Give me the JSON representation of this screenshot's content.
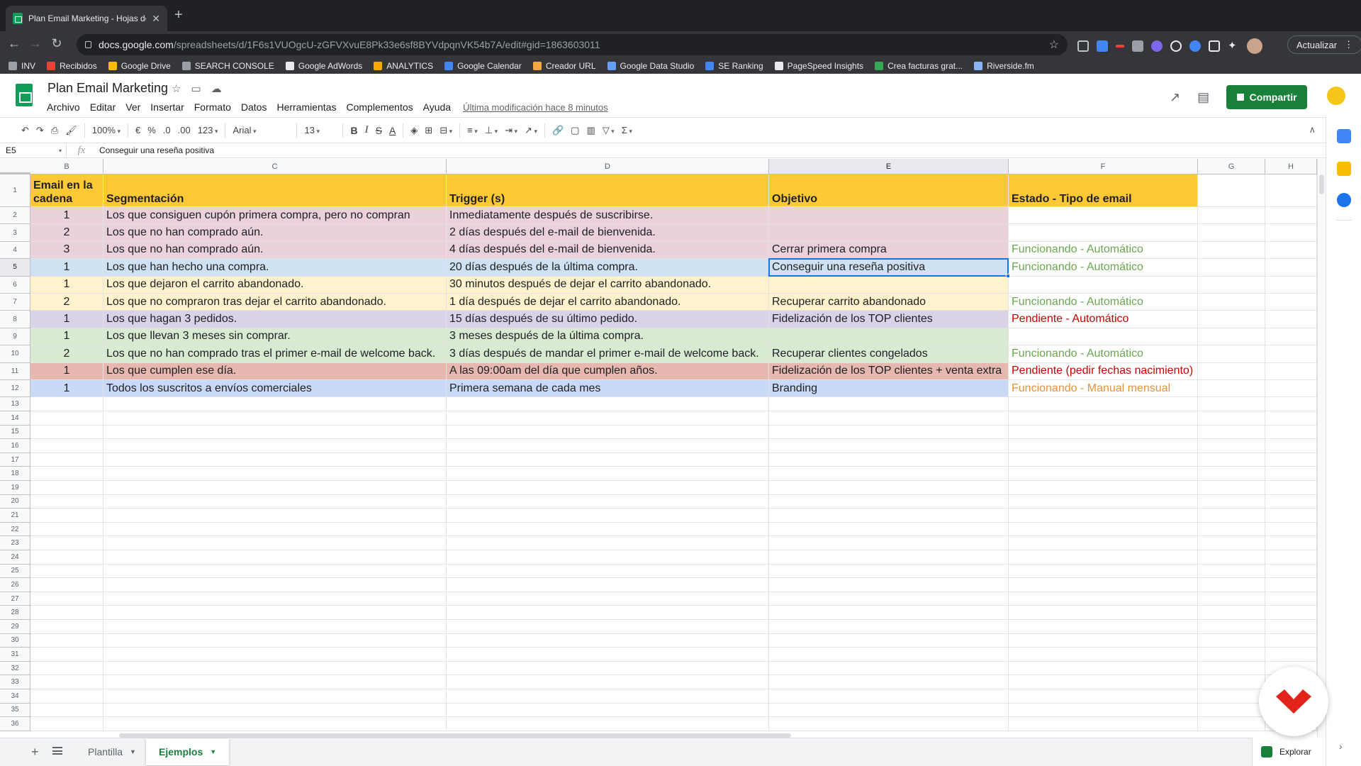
{
  "browser": {
    "tab_title": "Plan Email Marketing - Hojas de cálculo de Google",
    "url_host": "docs.google.com",
    "url_path": "/spreadsheets/d/1F6s1VUOgcU-zGFVXvuE8Pk33e6sf8BYVdpqnVK54b7A/edit#gid=1863603011",
    "update_label": "Actualizar",
    "bookmarks": [
      {
        "label": "INV",
        "color": "#9aa0a6"
      },
      {
        "label": "Recibidos",
        "color": "#ea4335"
      },
      {
        "label": "Google Drive",
        "color": "#fbbc04"
      },
      {
        "label": "SEARCH CONSOLE",
        "color": "#9aa0a6"
      },
      {
        "label": "Google AdWords",
        "color": "#e8eaed"
      },
      {
        "label": "ANALYTICS",
        "color": "#f9ab00"
      },
      {
        "label": "Google Calendar",
        "color": "#4285f4"
      },
      {
        "label": "Creador URL",
        "color": "#f4a742"
      },
      {
        "label": "Google Data Studio",
        "color": "#669df6"
      },
      {
        "label": "SE Ranking",
        "color": "#4285f4"
      },
      {
        "label": "PageSpeed Insights",
        "color": "#e8eaed"
      },
      {
        "label": "Crea facturas grat...",
        "color": "#34a853"
      },
      {
        "label": "Riverside.fm",
        "color": "#8ab4f8"
      }
    ]
  },
  "doc": {
    "title": "Plan Email Marketing",
    "menus": [
      "Archivo",
      "Editar",
      "Ver",
      "Insertar",
      "Formato",
      "Datos",
      "Herramientas",
      "Complementos",
      "Ayuda"
    ],
    "last_edit": "Última modificación hace 8 minutos",
    "share_label": "Compartir"
  },
  "format_toolbar": {
    "zoom": "100%",
    "currency": "€",
    "percent": "%",
    "decimal_less": ".0",
    "decimal_more": ".00",
    "more_formats": "123",
    "font": "Arial",
    "font_size": "13"
  },
  "formula_bar": {
    "cell_ref": "E5",
    "fx": "fx",
    "content": "Conseguir una reseña positiva"
  },
  "columns": [
    "B",
    "C",
    "D",
    "E",
    "F",
    "G",
    "H"
  ],
  "selected_column": "E",
  "selected_row": 5,
  "row_numbers": [
    1,
    2,
    3,
    4,
    5,
    6,
    7,
    8,
    9,
    10,
    11,
    12,
    13,
    14,
    15,
    16,
    17,
    18,
    19,
    20,
    21,
    22,
    23,
    24,
    25,
    26,
    27,
    28,
    29,
    30,
    31,
    32,
    33,
    34,
    35,
    36
  ],
  "header_row": {
    "b": "Email en la cadena",
    "c": "Segmentación",
    "d": "Trigger (s)",
    "e": "Objetivo",
    "f": "Estado - Tipo de email"
  },
  "rows": [
    {
      "b": "1",
      "c": "Los que consiguen cupón primera compra, pero no compran",
      "d": "Inmediatamente después de suscribirse.",
      "e": "",
      "f": "",
      "fill": "#ead1dc",
      "f_fill": "#ffffff",
      "f_color": ""
    },
    {
      "b": "2",
      "c": "Los que no han comprado aún.",
      "d": "2 días después del e-mail de bienvenida.",
      "e": "",
      "f": "",
      "fill": "#ead1dc",
      "f_fill": "#ffffff",
      "f_color": ""
    },
    {
      "b": "3",
      "c": "Los que no han comprado aún.",
      "d": "4 días después del e-mail de bienvenida.",
      "e": "Cerrar primera compra",
      "f": "Funcionando - Automático",
      "fill": "#ead1dc",
      "f_fill": "#ffffff",
      "f_color": "f-green"
    },
    {
      "b": "1",
      "c": "Los que han hecho una compra.",
      "d": "20 días después de la última compra.",
      "e": "Conseguir una reseña positiva",
      "f": "Funcionando - Automático",
      "fill": "#cfe2f3",
      "f_fill": "#ffffff",
      "f_color": "f-green"
    },
    {
      "b": "1",
      "c": "Los que dejaron el carrito abandonado.",
      "d": "30 minutos después de dejar el carrito abandonado.",
      "e": "",
      "f": "",
      "fill": "#fff2cc",
      "f_fill": "#ffffff",
      "f_color": ""
    },
    {
      "b": "2",
      "c": "Los que no compraron tras dejar el carrito abandonado.",
      "d": "1 día después de dejar el carrito abandonado.",
      "e": "Recuperar carrito abandonado",
      "f": "Funcionando - Automático",
      "fill": "#fff2cc",
      "f_fill": "#ffffff",
      "f_color": "f-green"
    },
    {
      "b": "1",
      "c": "Los que hagan 3 pedidos.",
      "d": "15 días después de su último pedido.",
      "e": "Fidelización de los TOP clientes",
      "f": "Pendiente - Automático",
      "fill": "#d9d2e9",
      "f_fill": "#ffffff",
      "f_color": "f-red"
    },
    {
      "b": "1",
      "c": "Los que llevan 3 meses sin comprar.",
      "d": "3 meses después de la última compra.",
      "e": "",
      "f": "",
      "fill": "#d9ead3",
      "f_fill": "#ffffff",
      "f_color": ""
    },
    {
      "b": "2",
      "c": "Los que no han comprado tras el primer e-mail de welcome back.",
      "d": "3 días después de mandar el primer e-mail de welcome back.",
      "e": "Recuperar clientes congelados",
      "f": "Funcionando - Automático",
      "fill": "#d9ead3",
      "f_fill": "#ffffff",
      "f_color": "f-green"
    },
    {
      "b": "1",
      "c": "Los que cumplen ese día.",
      "d": "A las 09:00am del día que cumplen años.",
      "e": "Fidelización de los TOP clientes + venta extra",
      "f": "Pendiente (pedir fechas nacimiento)",
      "fill": "#e6b8af",
      "f_fill": "#ffffff",
      "f_color": "f-red"
    },
    {
      "b": "1",
      "c": "Todos los suscritos a envíos comerciales",
      "d": "Primera semana de cada mes",
      "e": "Branding",
      "f": "Funcionando - Manual mensual",
      "fill": "#c9daf8",
      "f_fill": "#ffffff",
      "f_color": "f-orange"
    }
  ],
  "colors": {
    "header_fill": "#ffc935",
    "accent_green": "#188038",
    "selection_blue": "#1a73e8"
  },
  "sheets": [
    {
      "label": "Plantilla",
      "active": false
    },
    {
      "label": "Ejemplos",
      "active": true
    }
  ],
  "explore_label": "Explorar"
}
